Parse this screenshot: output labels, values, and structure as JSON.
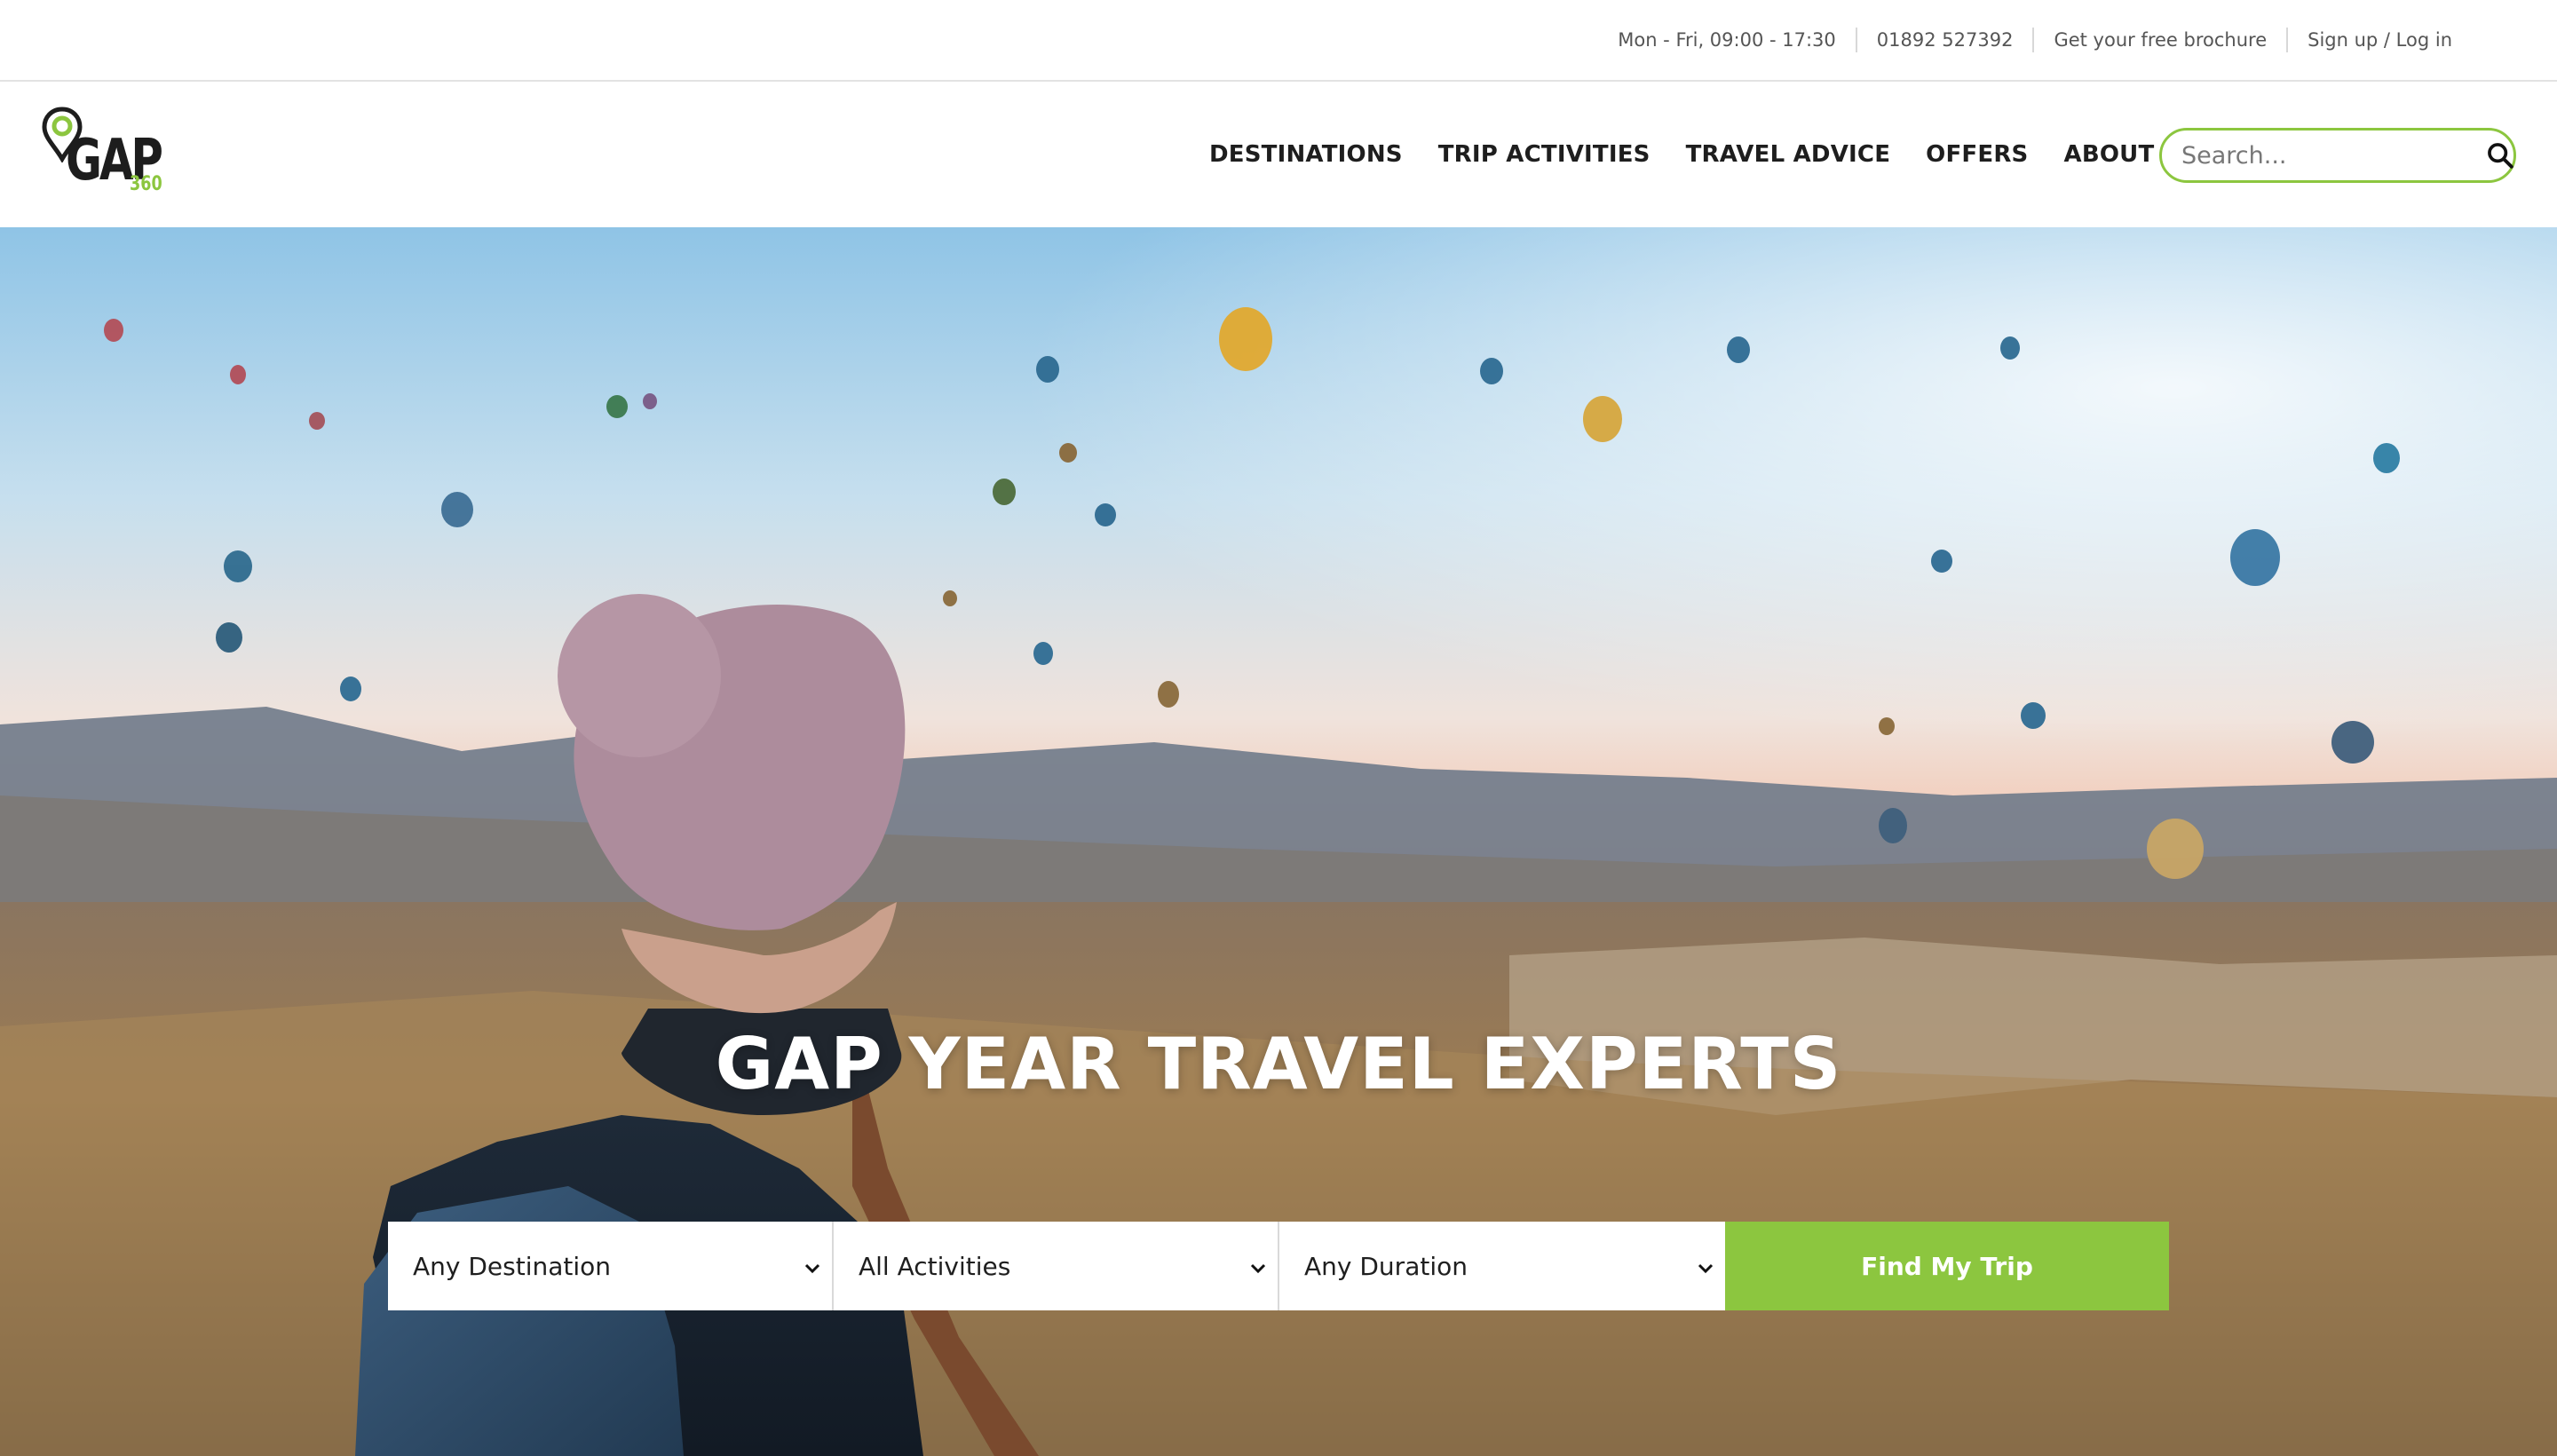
{
  "utility_bar": {
    "hours": "Mon - Fri, 09:00 - 17:30",
    "phone": "01892 527392",
    "brochure_link": "Get your free brochure",
    "account_link": "Sign up / Log in"
  },
  "brand": {
    "logo_text": "GAP",
    "logo_suffix": "360",
    "accent_color": "#8cc63f"
  },
  "nav": {
    "items": [
      "DESTINATIONS",
      "TRIP ACTIVITIES",
      "TRAVEL ADVICE",
      "OFFERS",
      "ABOUT US"
    ]
  },
  "search": {
    "placeholder": "Search...",
    "icon": "search-icon"
  },
  "hero": {
    "title": "GAP YEAR TRAVEL EXPERTS"
  },
  "trip_finder": {
    "destination": "Any Destination",
    "activities": "All Activities",
    "duration": "Any Duration",
    "submit_label": "Find My Trip"
  }
}
